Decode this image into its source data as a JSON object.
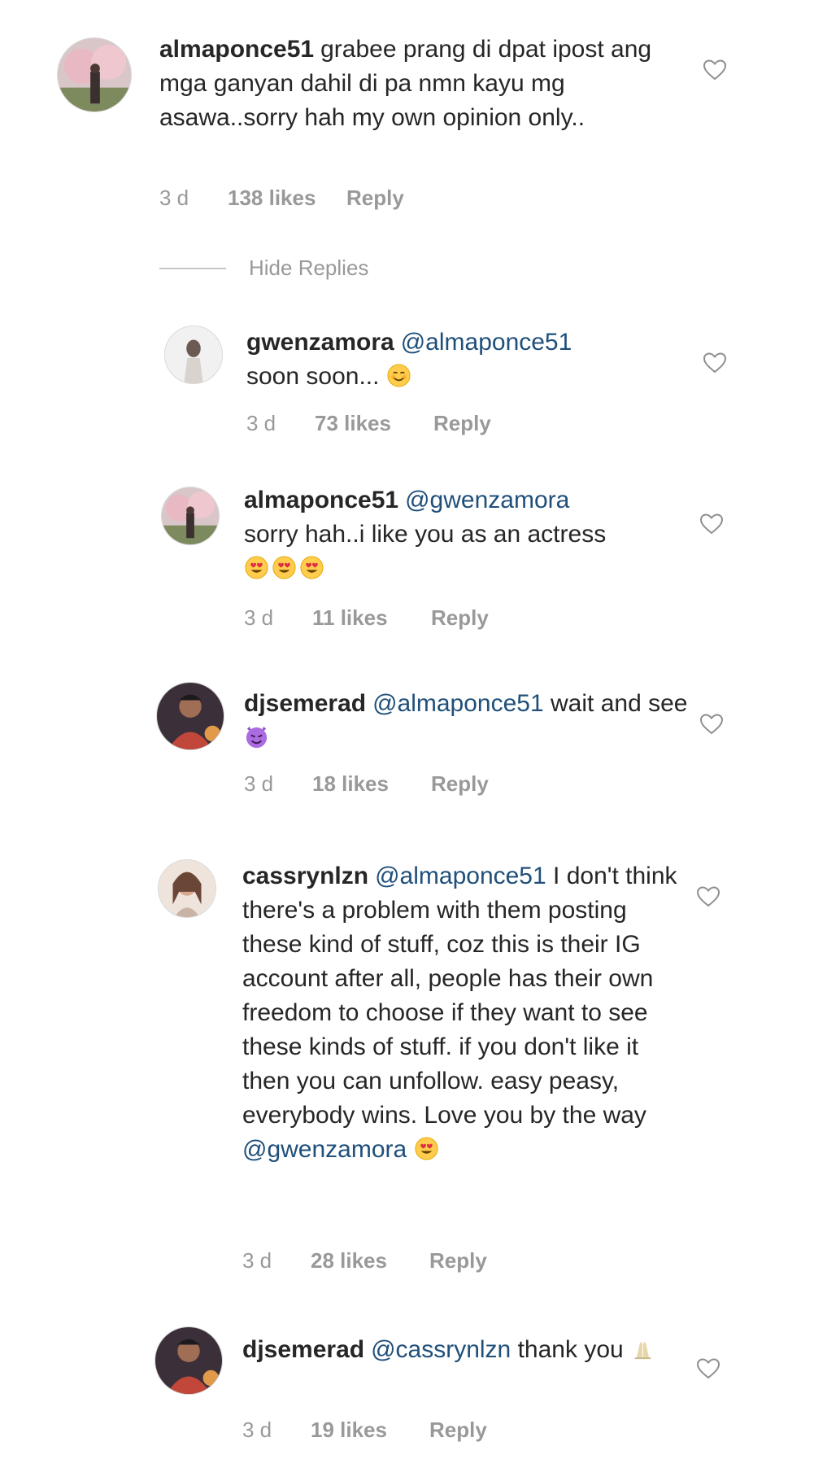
{
  "hide_replies_label": "Hide Replies",
  "colors": {
    "text": "#262626",
    "meta": "#999999",
    "mention": "#1f4f7a",
    "divider": "#c7c7c7"
  },
  "comments": [
    {
      "username": "almaponce51",
      "mention": "",
      "text": "grabee prang di dpat ipost ang mga ganyan dahil di pa nmn kayu mg asawa..sorry hah my own opinion only..",
      "emojis": [],
      "time": "3 d",
      "likes": "138 likes",
      "reply": "Reply"
    },
    {
      "username": "gwenzamora",
      "mention": "@almaponce51",
      "text": "soon soon...",
      "emojis": [
        "smiling-face-with-smiling-eyes"
      ],
      "time": "3 d",
      "likes": "73 likes",
      "reply": "Reply"
    },
    {
      "username": "almaponce51",
      "mention": "@gwenzamora",
      "text": "sorry hah..i like you as an actress",
      "emojis": [
        "heart-eyes",
        "heart-eyes",
        "heart-eyes"
      ],
      "time": "3 d",
      "likes": "11 likes",
      "reply": "Reply"
    },
    {
      "username": "djsemerad",
      "mention": "@almaponce51",
      "text": "wait and see",
      "emojis": [
        "smiling-imp"
      ],
      "time": "3 d",
      "likes": "18 likes",
      "reply": "Reply"
    },
    {
      "username": "cassrynlzn",
      "mention": "@almaponce51",
      "text": "I don't think there's a problem with them posting these kind of stuff, coz this is their IG account after all, people has their own freedom to choose if they want to see these kinds of stuff. if you don't like it then you can unfollow. easy peasy, everybody wins. Love you by the way",
      "mention_end": "@gwenzamora",
      "emojis": [
        "heart-eyes"
      ],
      "time": "3 d",
      "likes": "28 likes",
      "reply": "Reply"
    },
    {
      "username": "djsemerad",
      "mention": "@cassrynlzn",
      "text": "thank you",
      "emojis": [
        "folded-hands"
      ],
      "time": "3 d",
      "likes": "19 likes",
      "reply": "Reply"
    }
  ]
}
